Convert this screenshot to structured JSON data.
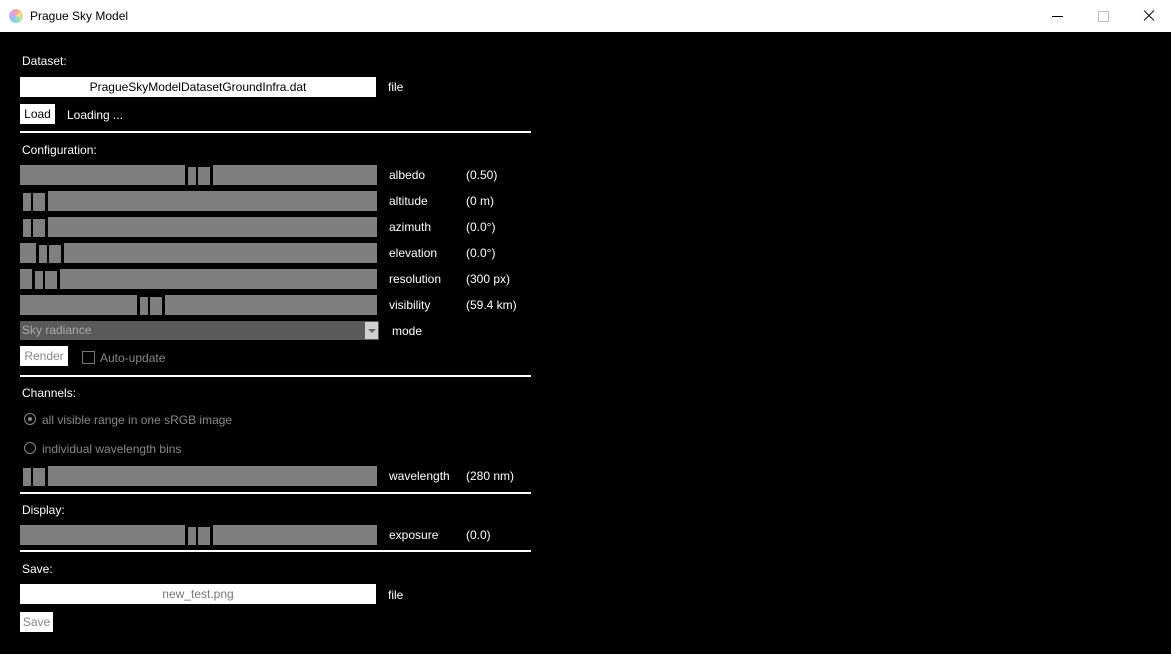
{
  "window": {
    "title": "Prague Sky Model"
  },
  "dataset": {
    "heading": "Dataset:",
    "file_value": "PragueSkyModelDatasetGroundInfra.dat",
    "file_label": "file",
    "load_label": "Load",
    "status": "Loading ..."
  },
  "configuration": {
    "heading": "Configuration:",
    "sliders": [
      {
        "name": "albedo",
        "display": "(0.50)",
        "fraction": 0.5
      },
      {
        "name": "altitude",
        "display": "(0 m)",
        "fraction": 0.0
      },
      {
        "name": "azimuth",
        "display": "(0.0°)",
        "fraction": 0.0
      },
      {
        "name": "elevation",
        "display": "(0.0°)",
        "fraction": 0.05
      },
      {
        "name": "resolution",
        "display": "(300 px)",
        "fraction": 0.035
      },
      {
        "name": "visibility",
        "display": "(59.4 km)",
        "fraction": 0.355
      }
    ],
    "mode_value": "Sky radiance",
    "mode_label": "mode",
    "render_label": "Render",
    "auto_update_label": "Auto-update",
    "auto_update_checked": false
  },
  "channels": {
    "heading": "Channels:",
    "option_all": "all visible range in one sRGB image",
    "option_bins": "individual wavelength bins",
    "selected": "all",
    "wavelength": {
      "name": "wavelength",
      "display": "(280 nm)",
      "fraction": 0.0
    }
  },
  "display": {
    "heading": "Display:",
    "exposure": {
      "name": "exposure",
      "display": "(0.0)",
      "fraction": 0.5
    }
  },
  "save": {
    "heading": "Save:",
    "file_value": "new_test.png",
    "file_label": "file",
    "save_label": "Save"
  }
}
